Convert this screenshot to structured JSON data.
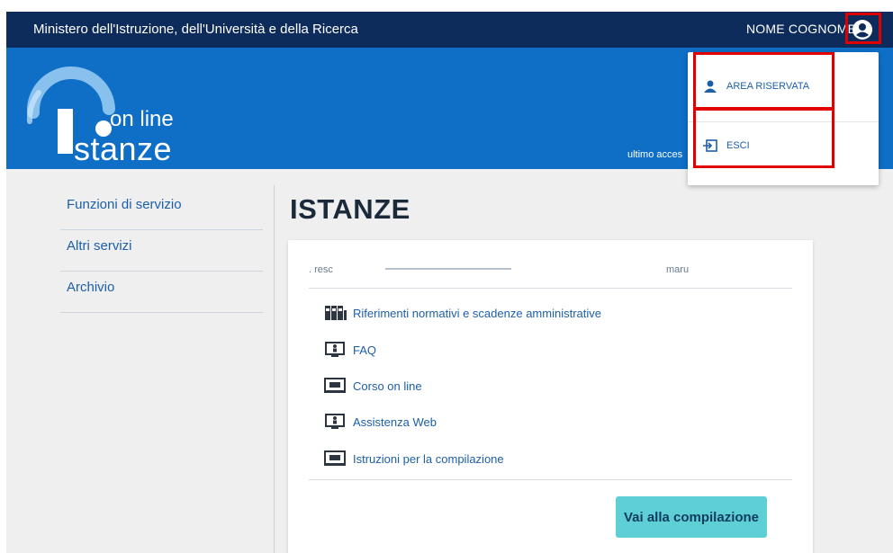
{
  "header": {
    "ministry": "Ministero dell'Istruzione, dell'Università e della Ricerca",
    "user_name": "NOME COGNOME",
    "user_icon": "user-circle-icon"
  },
  "banner": {
    "logo_online": "on line",
    "logo_istanze": "stanze",
    "last_access": "ultimo acces"
  },
  "sidebar": {
    "items": [
      {
        "label": "Funzioni di servizio"
      },
      {
        "label": "Altri servizi"
      },
      {
        "label": "Archivio"
      }
    ]
  },
  "main": {
    "title": "ISTANZE",
    "card": {
      "header_left": ". resc",
      "header_right": "maru",
      "links": [
        {
          "label": "Riferimenti normativi e scadenze amministrative",
          "icon": "binders-icon"
        },
        {
          "label": "FAQ",
          "icon": "monitor-person-icon"
        },
        {
          "label": "Corso on line",
          "icon": "monitor-video-icon"
        },
        {
          "label": "Assistenza Web",
          "icon": "monitor-person-icon"
        },
        {
          "label": "Istruzioni per la compilazione",
          "icon": "monitor-video-icon"
        }
      ],
      "button": "Vai alla compilazione"
    }
  },
  "dropdown": {
    "items": [
      {
        "label": "AREA RISERVATA",
        "icon": "person-icon"
      },
      {
        "label": "ESCI",
        "icon": "logout-icon"
      }
    ]
  },
  "colors": {
    "topbar": "#0d2c5c",
    "banner": "#0f6fc6",
    "link": "#1c5fa8",
    "button": "#5fcfd6",
    "highlight": "#e00000"
  }
}
